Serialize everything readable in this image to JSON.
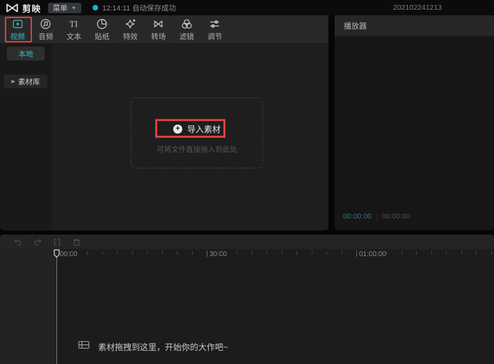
{
  "header": {
    "app_name": "剪映",
    "menu_label": "菜单",
    "status_text": "12:14:11 自动保存成功",
    "project_id": "202102241213"
  },
  "media_panel": {
    "tabs": [
      {
        "label": "视频",
        "icon": "video-play-icon",
        "active": true
      },
      {
        "label": "音频",
        "icon": "music-note-icon",
        "active": false
      },
      {
        "label": "文本",
        "icon": "text-ti-icon",
        "active": false
      },
      {
        "label": "贴纸",
        "icon": "sticker-icon",
        "active": false
      },
      {
        "label": "特效",
        "icon": "sparkle-icon",
        "active": false
      },
      {
        "label": "转场",
        "icon": "transition-bowtie-icon",
        "active": false
      },
      {
        "label": "滤镜",
        "icon": "filter-circles-icon",
        "active": false
      },
      {
        "label": "调节",
        "icon": "adjust-sliders-icon",
        "active": false
      }
    ],
    "sidebar": {
      "local_label": "本地",
      "library_label": "素材库"
    },
    "import": {
      "button_label": "导入素材",
      "plus_glyph": "+",
      "hint": "可将文件直接拖入到此处"
    }
  },
  "player": {
    "title": "播放器",
    "current_time": "00:00:00",
    "total_time": "00:00:00",
    "time_separator": "|"
  },
  "timeline": {
    "toolbar_icons": [
      "undo-icon",
      "redo-icon",
      "split-icon",
      "delete-icon"
    ],
    "ruler_labels": [
      {
        "text": "00:00"
      },
      {
        "text": "30:00"
      },
      {
        "text": "01:00:00"
      }
    ],
    "empty_hint": "素材拖拽到这里，开始你的大作吧~"
  },
  "colors": {
    "accent_teal": "#4ab8bd",
    "status_dot_teal": "#17b3c9",
    "annotation_red": "#e03d3d",
    "panel_dark": "#1e1e1e",
    "header_black": "#0b0b0c"
  }
}
